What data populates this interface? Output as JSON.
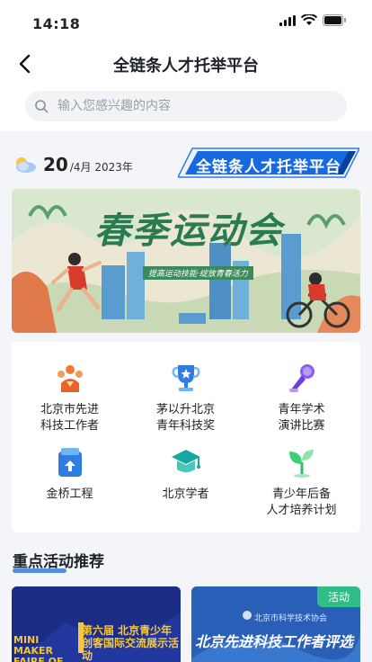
{
  "status_bar": {
    "time": "14:18"
  },
  "nav": {
    "title": "全链条人才托举平台"
  },
  "search": {
    "placeholder": "输入您感兴趣的内容"
  },
  "date": {
    "day": "20",
    "rest": "/4月 2023年"
  },
  "platform_badge": {
    "label": "全链条人才托举平台"
  },
  "banner": {
    "title": "春季运动会",
    "subtitle": "提高运动技能·绽放青春活力"
  },
  "grid": {
    "items": [
      {
        "label_line1": "北京市先进",
        "label_line2": "科技工作者",
        "icon": "people-group-icon"
      },
      {
        "label_line1": "茅以升北京",
        "label_line2": "青年科技奖",
        "icon": "trophy-icon"
      },
      {
        "label_line1": "青年学术",
        "label_line2": "演讲比赛",
        "icon": "microphone-icon"
      },
      {
        "label_line1": "金桥工程",
        "label_line2": "",
        "icon": "bridge-box-icon"
      },
      {
        "label_line1": "北京学者",
        "label_line2": "",
        "icon": "graduation-cap-icon"
      },
      {
        "label_line1": "青少年后备",
        "label_line2": "人才培养计划",
        "icon": "sprout-icon"
      }
    ]
  },
  "section": {
    "title": "重点活动推荐"
  },
  "activities": [
    {
      "line_a": "MINI MAKER FAIRE OF",
      "line_b": "第六届 北京青少年创客国际交流展示活动"
    },
    {
      "tag": "活动",
      "title": "北京先进科技工作者评选",
      "sub": "北京市科学技术协会"
    }
  ],
  "colors": {
    "accent": "#3a7dd8",
    "banner_green": "#2a7a52",
    "tag_green": "#2fbd8a"
  }
}
